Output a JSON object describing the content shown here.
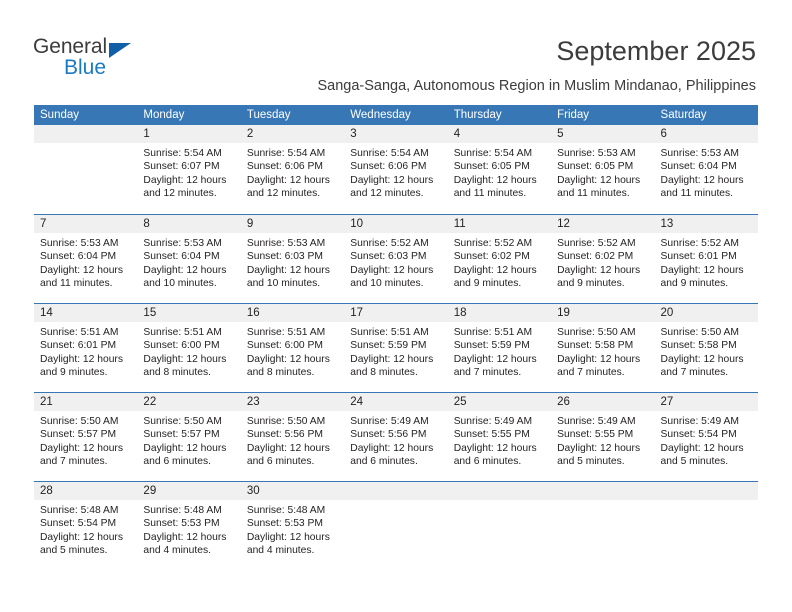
{
  "brand": {
    "name_top": "General",
    "name_bottom": "Blue"
  },
  "header": {
    "title": "September 2025",
    "subtitle": "Sanga-Sanga, Autonomous Region in Muslim Mindanao, Philippines"
  },
  "colors": {
    "header_blue": "#3877b5",
    "logo_blue": "#1a7ac4",
    "day_number_bg": "#f0f0f0",
    "text": "#231f20"
  },
  "weekdays": [
    "Sunday",
    "Monday",
    "Tuesday",
    "Wednesday",
    "Thursday",
    "Friday",
    "Saturday"
  ],
  "labels": {
    "sunrise": "Sunrise:",
    "sunset": "Sunset:",
    "daylight": "Daylight:"
  },
  "weeks": [
    [
      {
        "day": "",
        "sunrise": "",
        "sunset": "",
        "daylight_line1": "",
        "daylight_line2": ""
      },
      {
        "day": "1",
        "sunrise": "Sunrise: 5:54 AM",
        "sunset": "Sunset: 6:07 PM",
        "daylight_line1": "Daylight: 12 hours",
        "daylight_line2": "and 12 minutes."
      },
      {
        "day": "2",
        "sunrise": "Sunrise: 5:54 AM",
        "sunset": "Sunset: 6:06 PM",
        "daylight_line1": "Daylight: 12 hours",
        "daylight_line2": "and 12 minutes."
      },
      {
        "day": "3",
        "sunrise": "Sunrise: 5:54 AM",
        "sunset": "Sunset: 6:06 PM",
        "daylight_line1": "Daylight: 12 hours",
        "daylight_line2": "and 12 minutes."
      },
      {
        "day": "4",
        "sunrise": "Sunrise: 5:54 AM",
        "sunset": "Sunset: 6:05 PM",
        "daylight_line1": "Daylight: 12 hours",
        "daylight_line2": "and 11 minutes."
      },
      {
        "day": "5",
        "sunrise": "Sunrise: 5:53 AM",
        "sunset": "Sunset: 6:05 PM",
        "daylight_line1": "Daylight: 12 hours",
        "daylight_line2": "and 11 minutes."
      },
      {
        "day": "6",
        "sunrise": "Sunrise: 5:53 AM",
        "sunset": "Sunset: 6:04 PM",
        "daylight_line1": "Daylight: 12 hours",
        "daylight_line2": "and 11 minutes."
      }
    ],
    [
      {
        "day": "7",
        "sunrise": "Sunrise: 5:53 AM",
        "sunset": "Sunset: 6:04 PM",
        "daylight_line1": "Daylight: 12 hours",
        "daylight_line2": "and 11 minutes."
      },
      {
        "day": "8",
        "sunrise": "Sunrise: 5:53 AM",
        "sunset": "Sunset: 6:04 PM",
        "daylight_line1": "Daylight: 12 hours",
        "daylight_line2": "and 10 minutes."
      },
      {
        "day": "9",
        "sunrise": "Sunrise: 5:53 AM",
        "sunset": "Sunset: 6:03 PM",
        "daylight_line1": "Daylight: 12 hours",
        "daylight_line2": "and 10 minutes."
      },
      {
        "day": "10",
        "sunrise": "Sunrise: 5:52 AM",
        "sunset": "Sunset: 6:03 PM",
        "daylight_line1": "Daylight: 12 hours",
        "daylight_line2": "and 10 minutes."
      },
      {
        "day": "11",
        "sunrise": "Sunrise: 5:52 AM",
        "sunset": "Sunset: 6:02 PM",
        "daylight_line1": "Daylight: 12 hours",
        "daylight_line2": "and 9 minutes."
      },
      {
        "day": "12",
        "sunrise": "Sunrise: 5:52 AM",
        "sunset": "Sunset: 6:02 PM",
        "daylight_line1": "Daylight: 12 hours",
        "daylight_line2": "and 9 minutes."
      },
      {
        "day": "13",
        "sunrise": "Sunrise: 5:52 AM",
        "sunset": "Sunset: 6:01 PM",
        "daylight_line1": "Daylight: 12 hours",
        "daylight_line2": "and 9 minutes."
      }
    ],
    [
      {
        "day": "14",
        "sunrise": "Sunrise: 5:51 AM",
        "sunset": "Sunset: 6:01 PM",
        "daylight_line1": "Daylight: 12 hours",
        "daylight_line2": "and 9 minutes."
      },
      {
        "day": "15",
        "sunrise": "Sunrise: 5:51 AM",
        "sunset": "Sunset: 6:00 PM",
        "daylight_line1": "Daylight: 12 hours",
        "daylight_line2": "and 8 minutes."
      },
      {
        "day": "16",
        "sunrise": "Sunrise: 5:51 AM",
        "sunset": "Sunset: 6:00 PM",
        "daylight_line1": "Daylight: 12 hours",
        "daylight_line2": "and 8 minutes."
      },
      {
        "day": "17",
        "sunrise": "Sunrise: 5:51 AM",
        "sunset": "Sunset: 5:59 PM",
        "daylight_line1": "Daylight: 12 hours",
        "daylight_line2": "and 8 minutes."
      },
      {
        "day": "18",
        "sunrise": "Sunrise: 5:51 AM",
        "sunset": "Sunset: 5:59 PM",
        "daylight_line1": "Daylight: 12 hours",
        "daylight_line2": "and 7 minutes."
      },
      {
        "day": "19",
        "sunrise": "Sunrise: 5:50 AM",
        "sunset": "Sunset: 5:58 PM",
        "daylight_line1": "Daylight: 12 hours",
        "daylight_line2": "and 7 minutes."
      },
      {
        "day": "20",
        "sunrise": "Sunrise: 5:50 AM",
        "sunset": "Sunset: 5:58 PM",
        "daylight_line1": "Daylight: 12 hours",
        "daylight_line2": "and 7 minutes."
      }
    ],
    [
      {
        "day": "21",
        "sunrise": "Sunrise: 5:50 AM",
        "sunset": "Sunset: 5:57 PM",
        "daylight_line1": "Daylight: 12 hours",
        "daylight_line2": "and 7 minutes."
      },
      {
        "day": "22",
        "sunrise": "Sunrise: 5:50 AM",
        "sunset": "Sunset: 5:57 PM",
        "daylight_line1": "Daylight: 12 hours",
        "daylight_line2": "and 6 minutes."
      },
      {
        "day": "23",
        "sunrise": "Sunrise: 5:50 AM",
        "sunset": "Sunset: 5:56 PM",
        "daylight_line1": "Daylight: 12 hours",
        "daylight_line2": "and 6 minutes."
      },
      {
        "day": "24",
        "sunrise": "Sunrise: 5:49 AM",
        "sunset": "Sunset: 5:56 PM",
        "daylight_line1": "Daylight: 12 hours",
        "daylight_line2": "and 6 minutes."
      },
      {
        "day": "25",
        "sunrise": "Sunrise: 5:49 AM",
        "sunset": "Sunset: 5:55 PM",
        "daylight_line1": "Daylight: 12 hours",
        "daylight_line2": "and 6 minutes."
      },
      {
        "day": "26",
        "sunrise": "Sunrise: 5:49 AM",
        "sunset": "Sunset: 5:55 PM",
        "daylight_line1": "Daylight: 12 hours",
        "daylight_line2": "and 5 minutes."
      },
      {
        "day": "27",
        "sunrise": "Sunrise: 5:49 AM",
        "sunset": "Sunset: 5:54 PM",
        "daylight_line1": "Daylight: 12 hours",
        "daylight_line2": "and 5 minutes."
      }
    ],
    [
      {
        "day": "28",
        "sunrise": "Sunrise: 5:48 AM",
        "sunset": "Sunset: 5:54 PM",
        "daylight_line1": "Daylight: 12 hours",
        "daylight_line2": "and 5 minutes."
      },
      {
        "day": "29",
        "sunrise": "Sunrise: 5:48 AM",
        "sunset": "Sunset: 5:53 PM",
        "daylight_line1": "Daylight: 12 hours",
        "daylight_line2": "and 4 minutes."
      },
      {
        "day": "30",
        "sunrise": "Sunrise: 5:48 AM",
        "sunset": "Sunset: 5:53 PM",
        "daylight_line1": "Daylight: 12 hours",
        "daylight_line2": "and 4 minutes."
      },
      {
        "day": "",
        "sunrise": "",
        "sunset": "",
        "daylight_line1": "",
        "daylight_line2": ""
      },
      {
        "day": "",
        "sunrise": "",
        "sunset": "",
        "daylight_line1": "",
        "daylight_line2": ""
      },
      {
        "day": "",
        "sunrise": "",
        "sunset": "",
        "daylight_line1": "",
        "daylight_line2": ""
      },
      {
        "day": "",
        "sunrise": "",
        "sunset": "",
        "daylight_line1": "",
        "daylight_line2": ""
      }
    ]
  ]
}
